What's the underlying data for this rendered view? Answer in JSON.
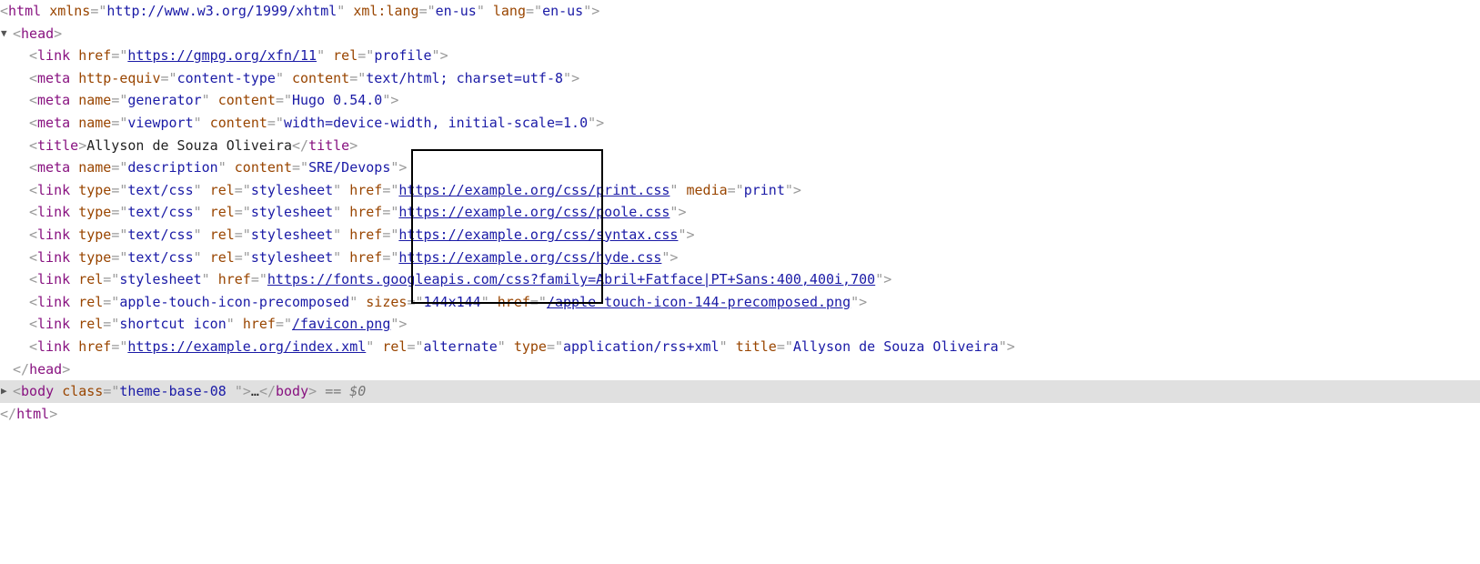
{
  "html_open": {
    "tag": "html",
    "attrs": [
      {
        "name": "xmlns",
        "value": "http://www.w3.org/1999/xhtml"
      },
      {
        "name": "xml:lang",
        "value": "en-us"
      },
      {
        "name": "lang",
        "value": "en-us"
      }
    ]
  },
  "head_open": {
    "tag": "head",
    "twisty": "▼"
  },
  "head_children": [
    {
      "tag": "link",
      "attrs": [
        {
          "name": "href",
          "value": "https://gmpg.org/xfn/11",
          "link": true
        },
        {
          "name": "rel",
          "value": "profile"
        }
      ]
    },
    {
      "tag": "meta",
      "attrs": [
        {
          "name": "http-equiv",
          "value": "content-type"
        },
        {
          "name": "content",
          "value": "text/html; charset=utf-8"
        }
      ]
    },
    {
      "tag": "meta",
      "attrs": [
        {
          "name": "name",
          "value": "generator"
        },
        {
          "name": "content",
          "value": "Hugo 0.54.0"
        }
      ]
    },
    {
      "tag": "meta",
      "attrs": [
        {
          "name": "name",
          "value": "viewport"
        },
        {
          "name": "content",
          "value": "width=device-width, initial-scale=1.0"
        }
      ]
    },
    {
      "tag": "title",
      "text": "Allyson de Souza Oliveira",
      "close": true
    },
    {
      "tag": "meta",
      "attrs": [
        {
          "name": "name",
          "value": "description"
        },
        {
          "name": "content",
          "value": "SRE/Devops"
        }
      ]
    },
    {
      "tag": "link",
      "attrs": [
        {
          "name": "type",
          "value": "text/css"
        },
        {
          "name": "rel",
          "value": "stylesheet"
        },
        {
          "name": "href",
          "value": "https://example.org/css/print.css",
          "link": true
        },
        {
          "name": "media",
          "value": "print"
        }
      ]
    },
    {
      "tag": "link",
      "attrs": [
        {
          "name": "type",
          "value": "text/css"
        },
        {
          "name": "rel",
          "value": "stylesheet"
        },
        {
          "name": "href",
          "value": "https://example.org/css/poole.css",
          "link": true
        }
      ]
    },
    {
      "tag": "link",
      "attrs": [
        {
          "name": "type",
          "value": "text/css"
        },
        {
          "name": "rel",
          "value": "stylesheet"
        },
        {
          "name": "href",
          "value": "https://example.org/css/syntax.css",
          "link": true
        }
      ]
    },
    {
      "tag": "link",
      "attrs": [
        {
          "name": "type",
          "value": "text/css"
        },
        {
          "name": "rel",
          "value": "stylesheet"
        },
        {
          "name": "href",
          "value": "https://example.org/css/hyde.css",
          "link": true
        }
      ]
    },
    {
      "tag": "link",
      "attrs": [
        {
          "name": "rel",
          "value": "stylesheet"
        },
        {
          "name": "href",
          "value": "https://fonts.googleapis.com/css?family=Abril+Fatface|PT+Sans:400,400i,700",
          "link": true
        }
      ]
    },
    {
      "tag": "link",
      "attrs": [
        {
          "name": "rel",
          "value": "apple-touch-icon-precomposed"
        },
        {
          "name": "sizes",
          "value": "144x144"
        },
        {
          "name": "href",
          "value": "/apple-touch-icon-144-precomposed.png",
          "link": true
        }
      ]
    },
    {
      "tag": "link",
      "attrs": [
        {
          "name": "rel",
          "value": "shortcut icon"
        },
        {
          "name": "href",
          "value": "/favicon.png",
          "link": true
        }
      ]
    },
    {
      "tag": "link",
      "attrs": [
        {
          "name": "href",
          "value": "https://example.org/index.xml",
          "link": true
        },
        {
          "name": "rel",
          "value": "alternate"
        },
        {
          "name": "type",
          "value": "application/rss+xml"
        },
        {
          "name": "title",
          "value": "Allyson de Souza Oliveira"
        }
      ]
    }
  ],
  "head_close": {
    "tag": "head"
  },
  "body_node": {
    "tag": "body",
    "twisty": "▶",
    "attr_name": "class",
    "attr_value": "theme-base-08 ",
    "ellipsis": "…",
    "selected_marker": "== $0"
  },
  "html_close": {
    "tag": "html"
  },
  "colors": {
    "tag": "#881280",
    "attribute": "#994500",
    "value": "#1a1aa6",
    "selected_row": "#e0e0e0"
  }
}
